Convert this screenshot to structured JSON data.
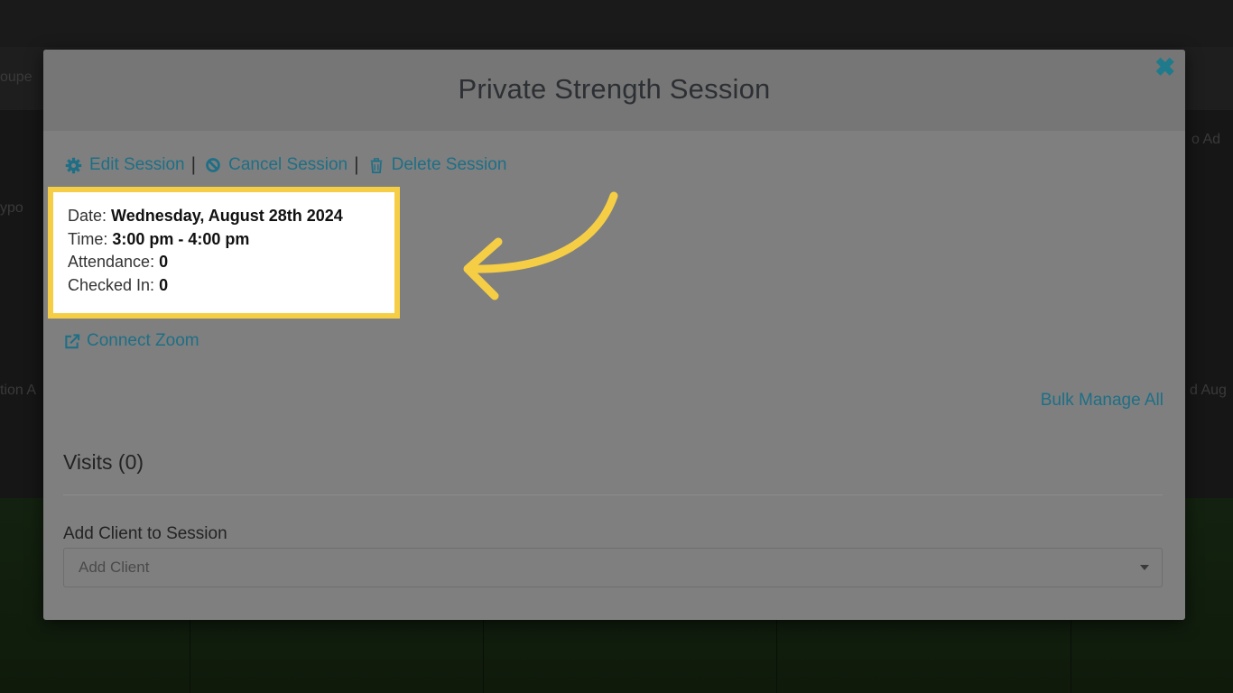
{
  "background": {
    "fragments": [
      "oupe",
      "ypo",
      "tion A",
      "d Aug",
      "o Ad"
    ]
  },
  "modal": {
    "title": "Private Strength Session",
    "close_icon": "close-icon",
    "actions": [
      {
        "label": "Edit Session",
        "icon": "gear-icon"
      },
      {
        "label": "Cancel Session",
        "icon": "ban-icon"
      },
      {
        "label": "Delete Session",
        "icon": "trash-icon"
      }
    ],
    "info": {
      "date_label": "Date:",
      "date_value": "Wednesday, August 28th 2024",
      "time_label": "Time:",
      "time_value": "3:00 pm - 4:00 pm",
      "attendance_label": "Attendance:",
      "attendance_value": "0",
      "checked_in_label": "Checked In:",
      "checked_in_value": "0"
    },
    "zoom_link": "Connect Zoom",
    "bulk_manage": "Bulk Manage All",
    "visits_title": "Visits (0)",
    "add_client_label": "Add Client to Session",
    "add_client_placeholder": "Add Client"
  },
  "colors": {
    "highlight": "#f6ce45",
    "link": "#1e6f86"
  }
}
